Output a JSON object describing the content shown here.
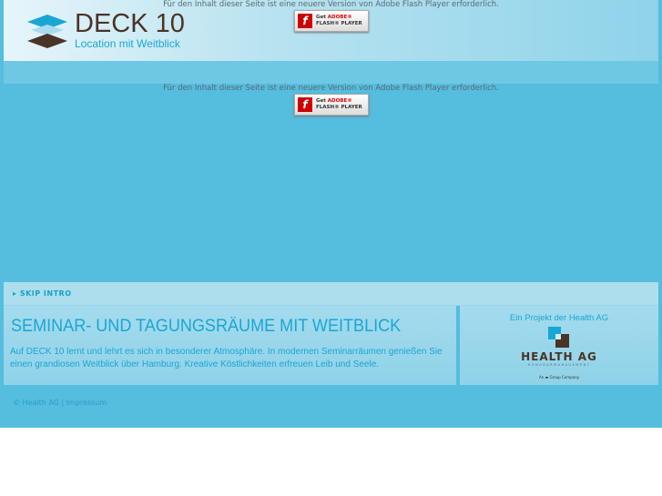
{
  "logo": {
    "title": "DECK 10",
    "tagline": "Location mit Weitblick"
  },
  "flash": {
    "message": "Für den Inhalt dieser Seite ist eine neuere Version von Adobe Flash Player erforderlich.",
    "button_get": "Get",
    "button_adobe": "ADOBE®",
    "button_player": "FLASH® PLAYER"
  },
  "skip_intro": "SKIP INTRO",
  "content": {
    "title": "SEMINAR- UND TAGUNGSRÄUME MIT WEITBLICK",
    "description": "Auf DECK 10 lernt und lehrt es sich in besonderer Atmosphäre. In modernen Seminarräumen genießen Sie einen grandiosen Weitblick über Hamburg. Kreative Köstlichkeiten erfreuen Leib und Seele."
  },
  "sponsor": {
    "label": "Ein Projekt der Health AG",
    "name": "HEALTH AG",
    "sub": "HONORARMANAGEMENT",
    "group": "An ▬ Group Company"
  },
  "footer": {
    "copyright": "© Health AG",
    "separator": "|",
    "impressum": "Impressum"
  }
}
